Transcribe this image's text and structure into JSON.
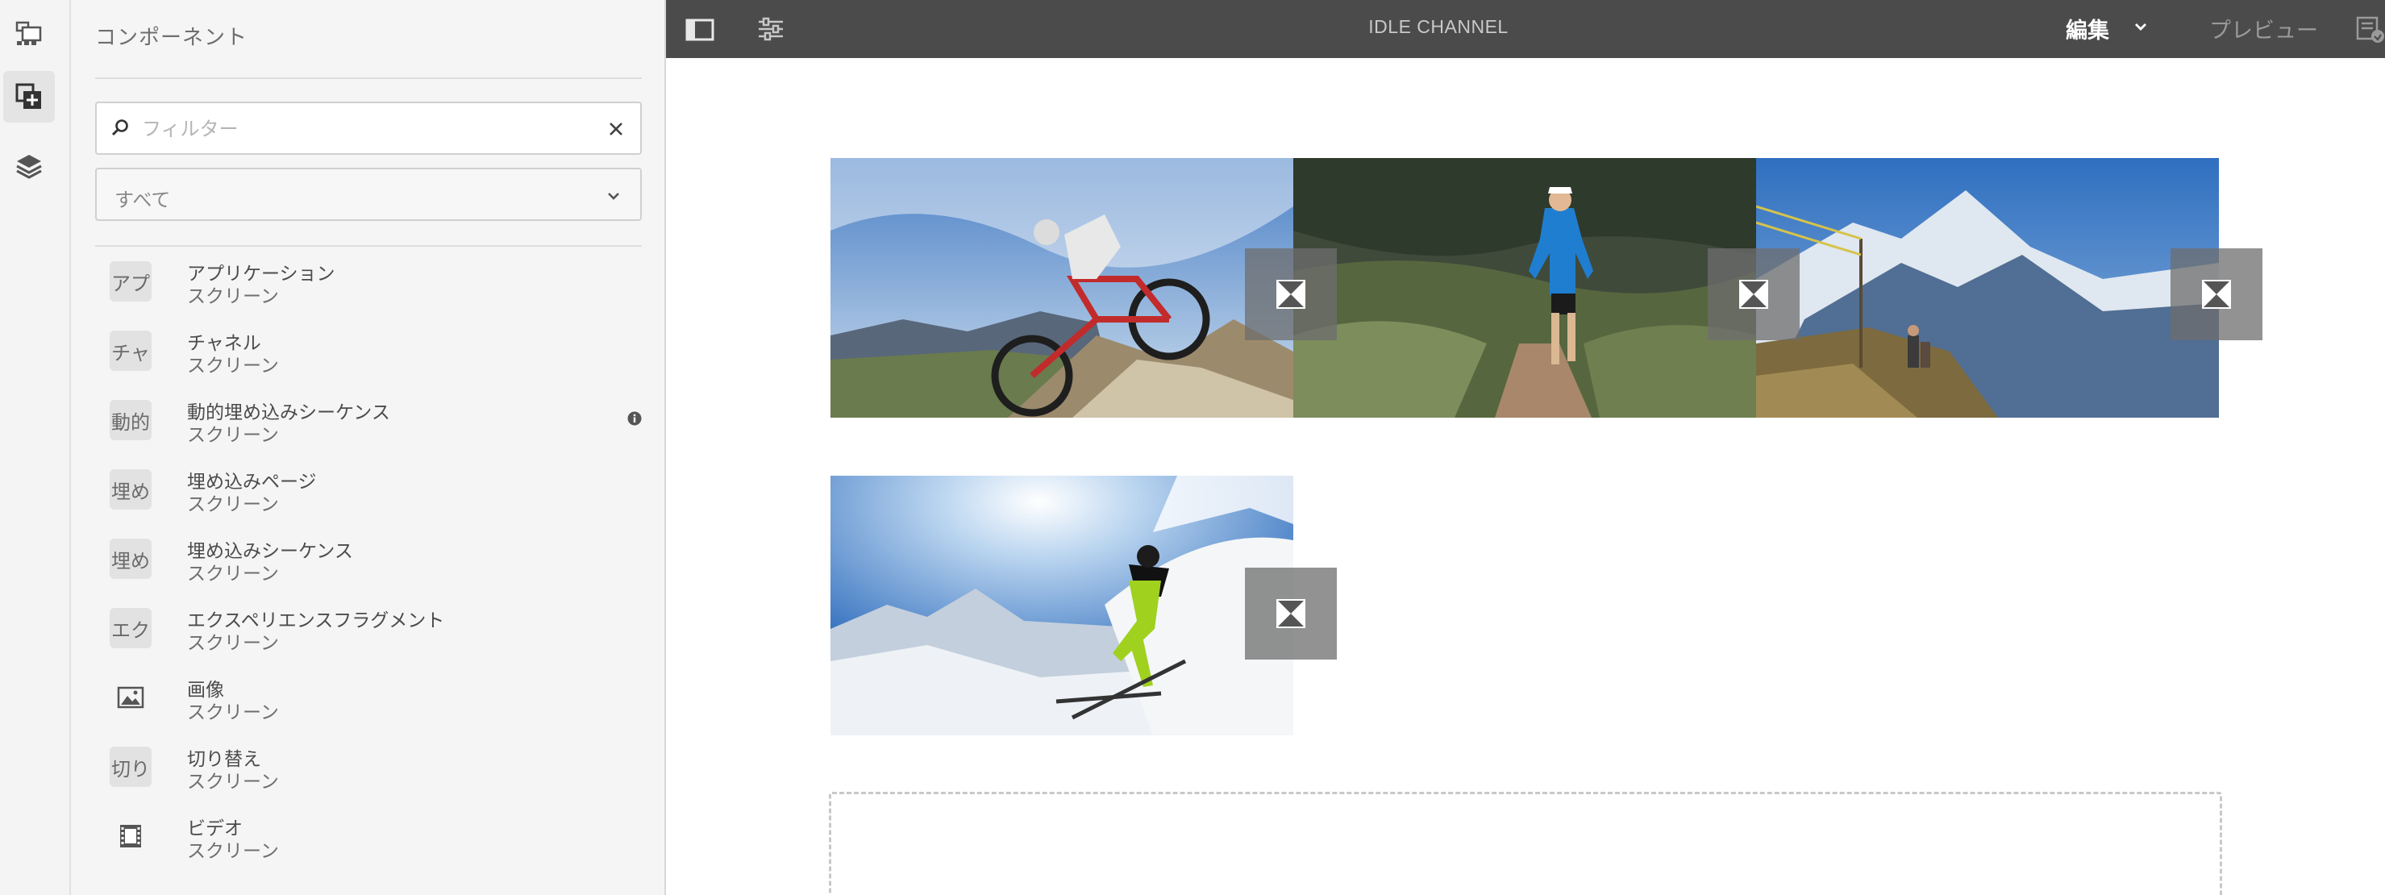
{
  "rail": {
    "items": [
      {
        "name": "sequence-icon",
        "active": false
      },
      {
        "name": "add-component-icon",
        "active": true
      },
      {
        "name": "layers-icon",
        "active": false
      }
    ]
  },
  "panel": {
    "title": "コンポーネント",
    "filter": {
      "placeholder": "フィルター",
      "value": ""
    },
    "group_select": {
      "selected": "すべて"
    },
    "components": [
      {
        "badge": "アプ",
        "name": "アプリケーション",
        "group": "スクリーン"
      },
      {
        "badge": "チャ",
        "name": "チャネル",
        "group": "スクリーン"
      },
      {
        "badge": "動的",
        "name": "動的埋め込みシーケンス",
        "group": "スクリーン",
        "info": true
      },
      {
        "badge": "埋め",
        "name": "埋め込みページ",
        "group": "スクリーン"
      },
      {
        "badge": "埋め",
        "name": "埋め込みシーケンス",
        "group": "スクリーン"
      },
      {
        "badge": "エク",
        "name": "エクスペリエンスフラグメント",
        "group": "スクリーン"
      },
      {
        "badge_icon": "image-icon",
        "name": "画像",
        "group": "スクリーン"
      },
      {
        "badge": "切り",
        "name": "切り替え",
        "group": "スクリーン"
      },
      {
        "badge_icon": "video-icon",
        "name": "ビデオ",
        "group": "スクリーン"
      }
    ]
  },
  "toolbar": {
    "title": "IDLE CHANNEL",
    "mode_label": "編集",
    "preview_label": "プレビュー"
  },
  "canvas": {
    "images": [
      {
        "subject": "mountain-bike"
      },
      {
        "subject": "trail-runner"
      },
      {
        "subject": "mountain-hikers"
      },
      {
        "subject": "skier"
      }
    ]
  }
}
